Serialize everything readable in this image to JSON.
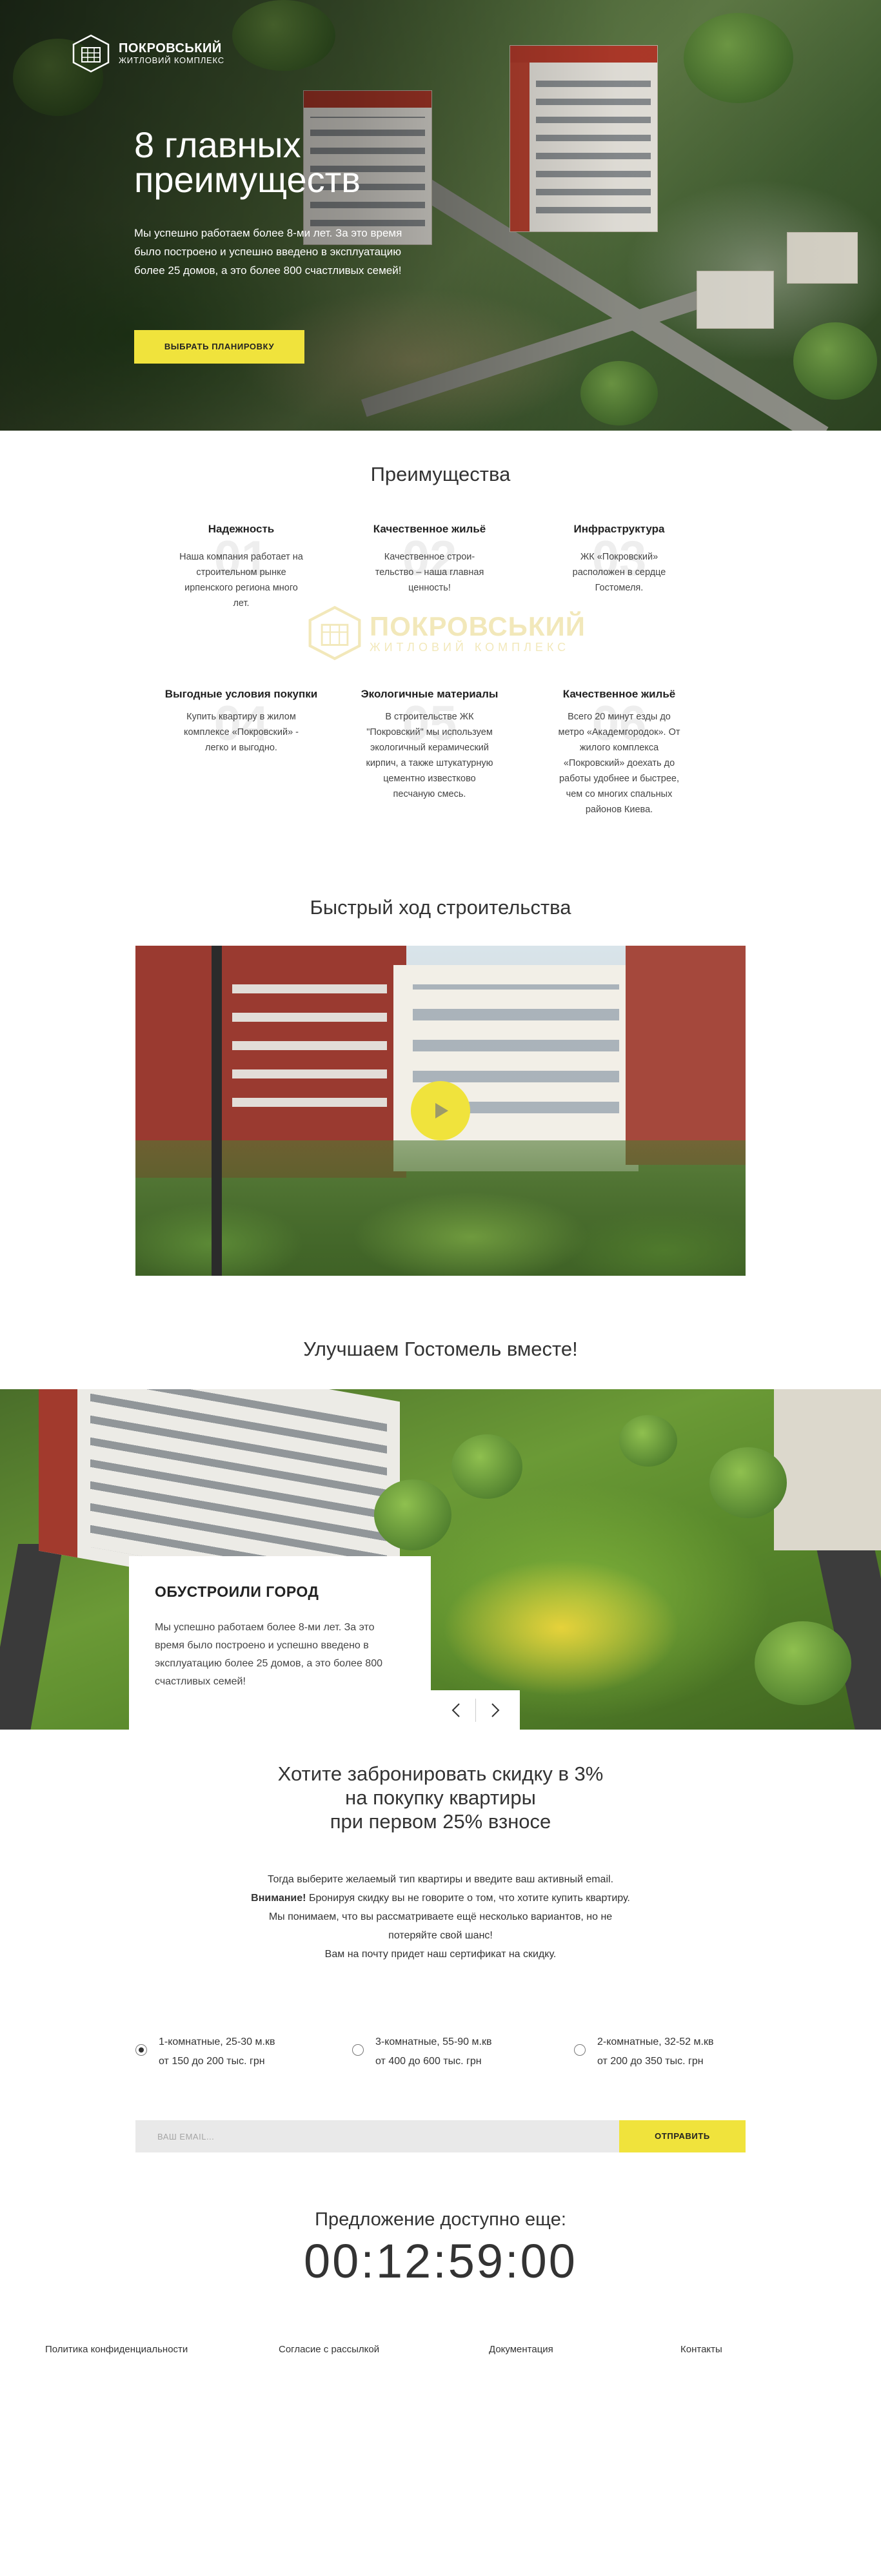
{
  "brand": {
    "name": "ПОКРОВСЬКИЙ",
    "subtitle": "ЖИТЛОВИЙ КОМПЛЕКС"
  },
  "hero": {
    "title": "8 главных преимуществ",
    "text": "Мы успешно работаем более 8-ми лет. За это время было построено и успешно введено в эксплуатацию более 25 домов, а это более 800 счастливых семей!",
    "button": "ВЫБРАТЬ ПЛАНИРОВКУ"
  },
  "advantages": {
    "title": "Преимущества",
    "items": [
      {
        "num": "01",
        "title": "Надежность",
        "text": "Наша компания работает на строительном рынке ирпенского региона много лет."
      },
      {
        "num": "02",
        "title": "Качественное жильё",
        "text": "Качественное строи- тельство – наша главная ценность!"
      },
      {
        "num": "03",
        "title": "Инфраструктура",
        "text": "ЖК «Покровский» расположен в сердце Гостомеля."
      },
      {
        "num": "04",
        "title": "Выгодные условия покупки",
        "text": "Купить квартиру в жилом комплексе «Покровский» - легко и выгодно."
      },
      {
        "num": "05",
        "title": "Экологичные материалы",
        "text": "В строительстве ЖК \"Покровский\" мы используем экологичный керамический кирпич, а также штукатурную цементно известково песчаную смесь."
      },
      {
        "num": "06",
        "title": "Качественное жильё",
        "text": "Всего 20 минут езды до метро «Академгородок». От жилого комплекса «Покровский» доехать до работы удобнее и быстрее, чем со многих спальных районов Киева."
      }
    ]
  },
  "construction": {
    "title": "Быстрый ход строительства"
  },
  "city": {
    "title": "Улучшаем Гостомель вместе!",
    "card_title": "ОБУСТРОИЛИ ГОРОД",
    "card_text": "Мы успешно работаем более 8-ми лет. За это время было построено и успешно введено в эксплуатацию более 25 домов, а это более 800 счастливых семей!"
  },
  "discount": {
    "title_lines": [
      "Хотите забронировать скидку в 3%",
      "на покупку квартиры",
      "при первом 25% взносе"
    ],
    "text_1": "Тогда выберите желаемый тип квартиры и введите ваш активный email.",
    "text_bold": "Внимание!",
    "text_2": "Бронируя скидку вы не говорите о том, что хотите купить квартиру. Мы понимаем, что вы рассматриваете ещё несколько вариантов, но не потеряйте свой шанс!",
    "text_3": "Вам на почту придет наш сертификат на скидку.",
    "options": [
      {
        "line1": "1-комнатные, 25-30 м.кв",
        "line2": "от 150 до 200 тыс. грн",
        "checked": true
      },
      {
        "line1": "3-комнатные, 55-90 м.кв",
        "line2": "от 400 до 600 тыс. грн",
        "checked": false
      },
      {
        "line1": "2-комнатные, 32-52 м.кв",
        "line2": "от 200 до 350 тыс. грн",
        "checked": false
      }
    ],
    "email_placeholder": "ВАШ EMAIL...",
    "submit": "ОТПРАВИТЬ"
  },
  "offer": {
    "title": "Предложение доступно еще:",
    "countdown": "00:12:59:00"
  },
  "footer": {
    "privacy": "Политика конфиденциальности",
    "newsletter": "Согласие с рассылкой",
    "docs": "Документация",
    "contacts": "Контакты"
  },
  "colors": {
    "accent": "#f0e33c",
    "text": "#333333"
  }
}
